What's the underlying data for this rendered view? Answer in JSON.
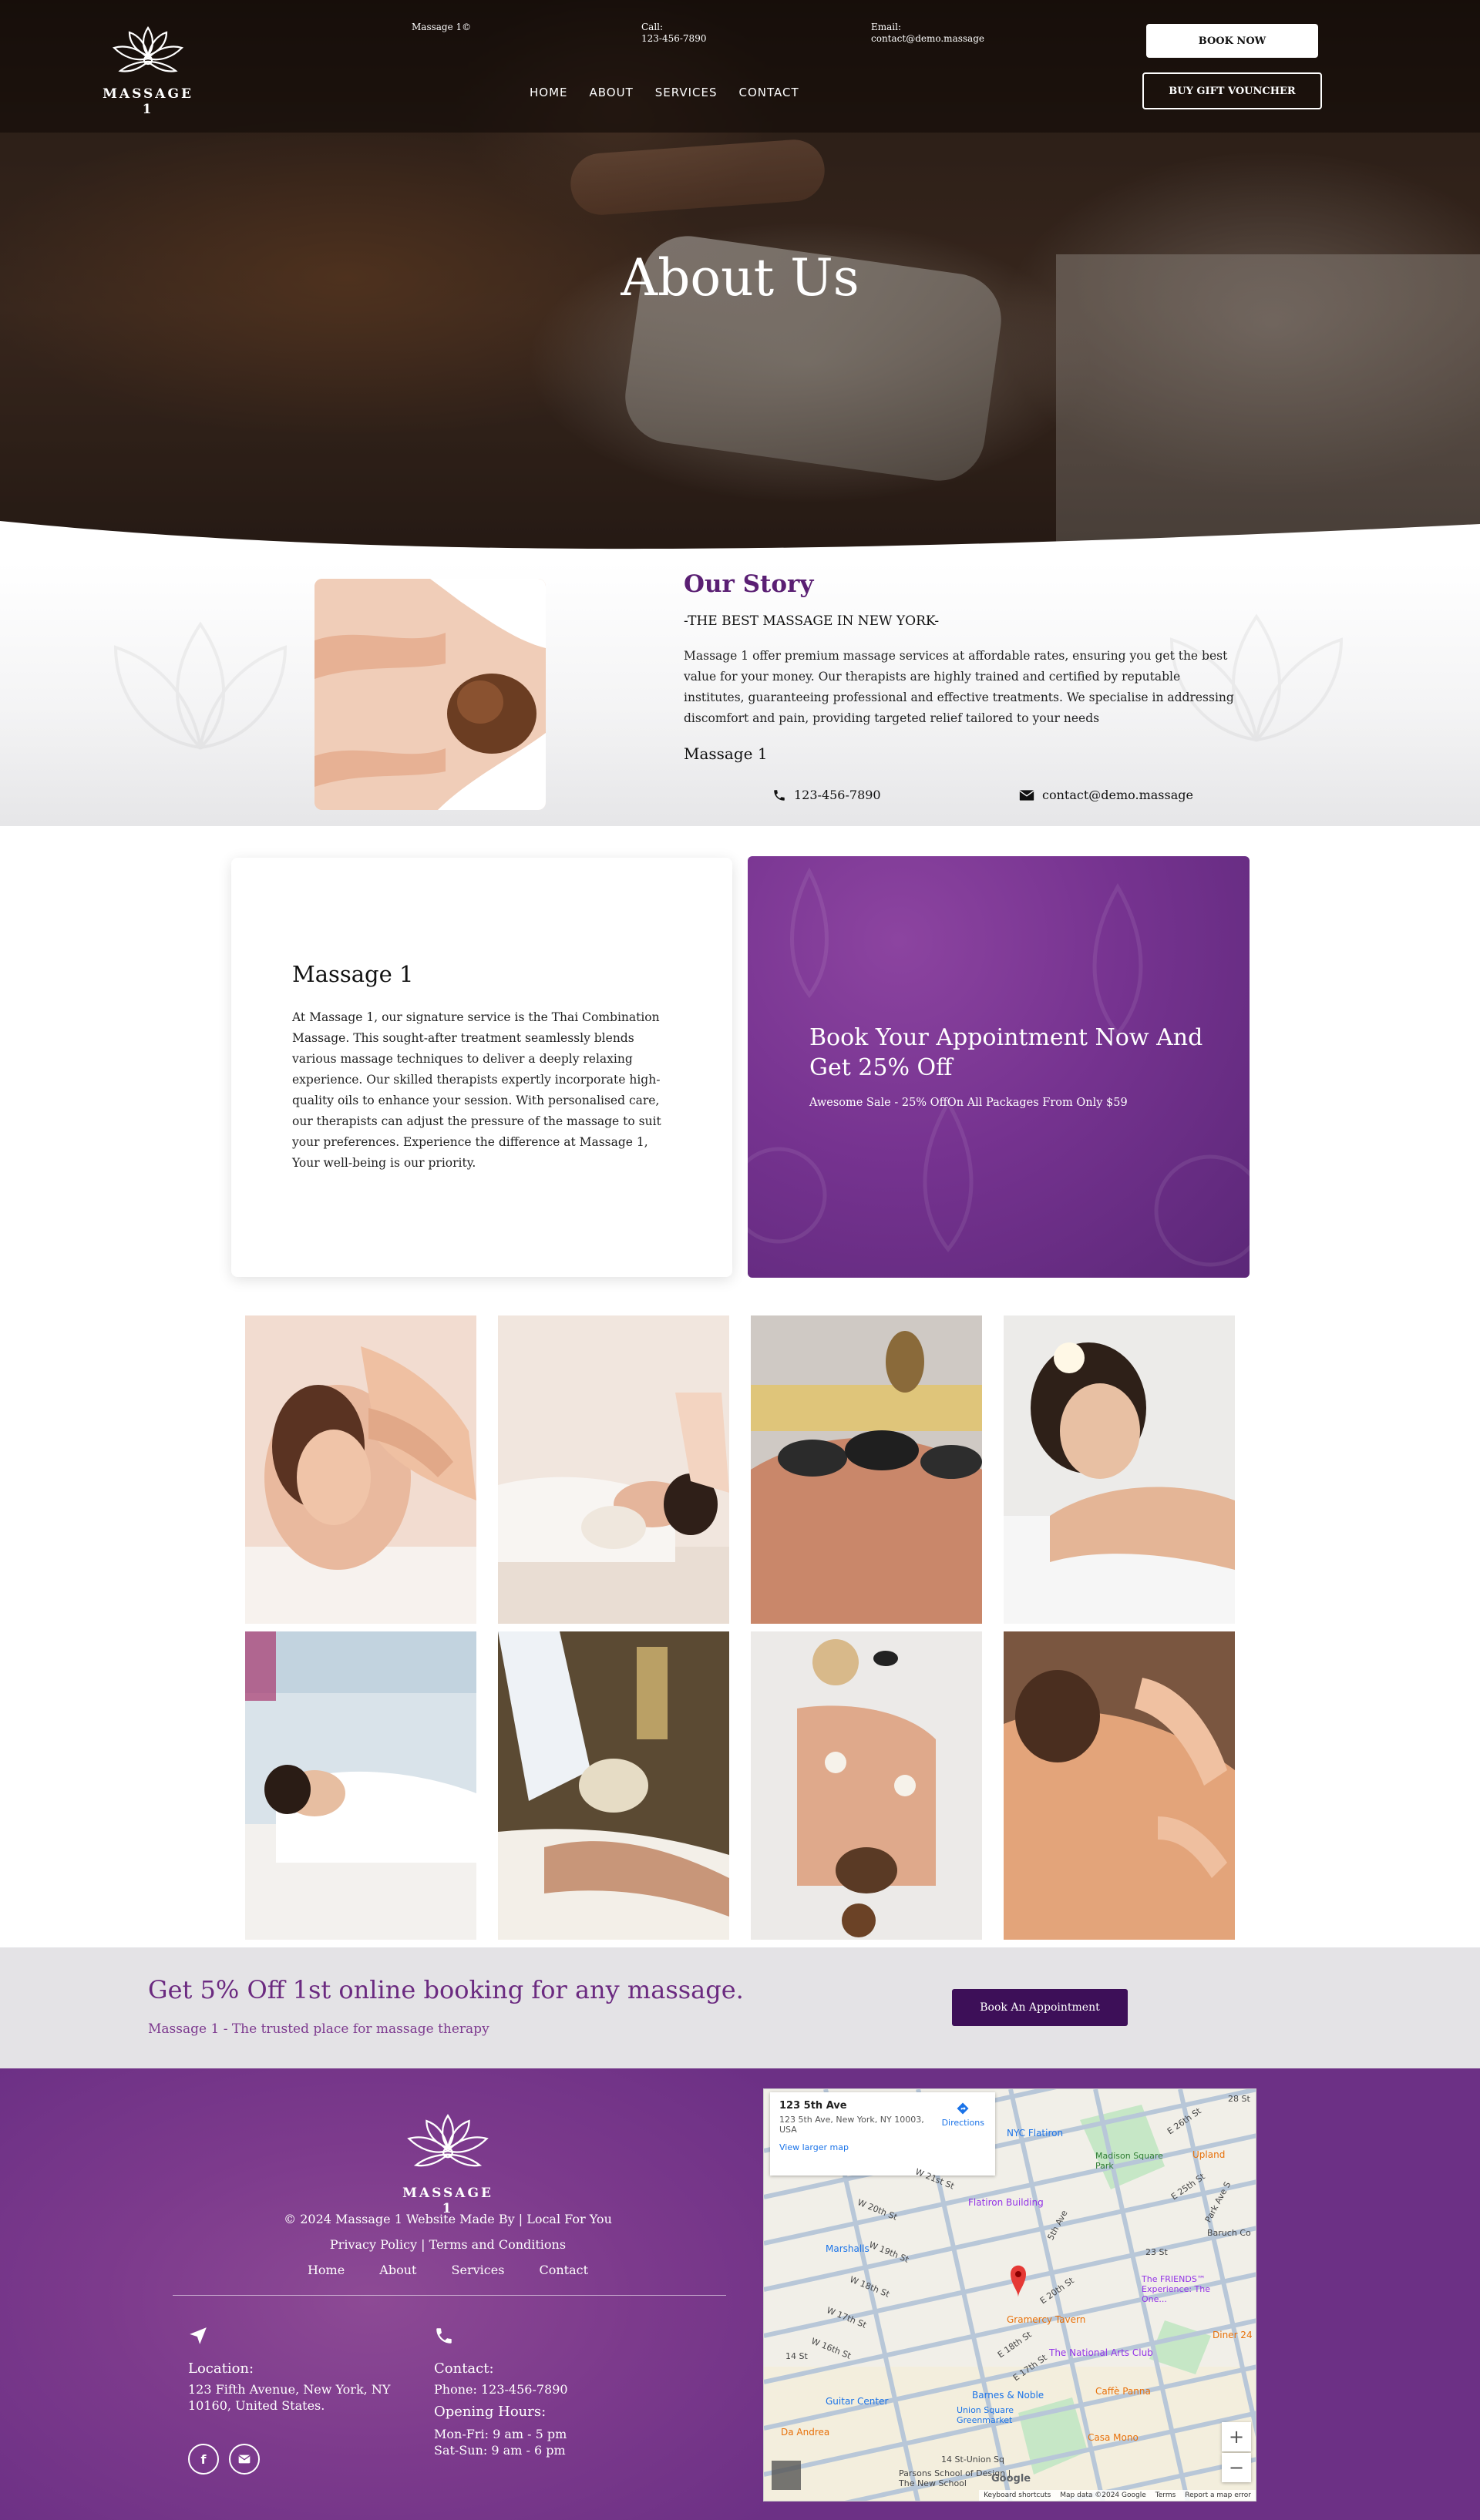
{
  "header": {
    "brand": "Massage 1",
    "logo_text": "MASSAGE 1",
    "site_name": "Massage 1©",
    "call_label": "Call:",
    "call_value": "123-456-7890",
    "email_label": "Email:",
    "email_value": "contact@demo.massage",
    "nav": [
      "HOME",
      "ABOUT",
      "SERVICES",
      "CONTACT"
    ],
    "book_now": "BOOK NOW",
    "gift_voucher": "BUY GIFT VOUNCHER"
  },
  "hero": {
    "title": "About Us"
  },
  "story": {
    "title": "Our Story",
    "subtitle": "-THE BEST MASSAGE IN NEW YORK-",
    "text": "Massage 1 offer premium massage services at affordable rates, ensuring you get the best value for your money. Our therapists are highly trained and certified by reputable institutes, guaranteeing professional and effective treatments. We specialise in addressing discomfort and pain, providing targeted relief tailored to your needs",
    "name": "Massage 1",
    "phone": "123-456-7890",
    "email": "contact@demo.massage"
  },
  "service_card": {
    "title": "Massage 1",
    "text": "At Massage 1, our signature service is the Thai Combination Massage. This sought-after treatment seamlessly blends various massage techniques to deliver a deeply relaxing experience. Our skilled therapists expertly incorporate high-quality oils to enhance your session. With personalised care, our therapists can adjust the pressure of the massage to suit your preferences. Experience the difference at Massage 1, Your well-being is our priority."
  },
  "offer_card": {
    "title": "Book Your Appointment Now And Get 25% Off",
    "text": "Awesome Sale - 25% OffOn All Packages From Only $59"
  },
  "gallery": {
    "items": [
      "shoulder-massage-photo",
      "head-massage-photo",
      "hot-stone-photo",
      "relaxing-woman-photo",
      "spa-rest-photo",
      "herbal-compress-photo",
      "back-treatment-photo",
      "back-massage-photo"
    ]
  },
  "promo": {
    "title": "Get 5% Off 1st online booking for any massage.",
    "subtitle": "Massage 1 - The trusted place for massage therapy",
    "button": "Book An Appointment"
  },
  "footer": {
    "logo_text": "MASSAGE 1",
    "copyright": "© 2024 Massage 1 Website Made By | Local For You",
    "legal": "Privacy Policy | Terms and Conditions",
    "links": [
      "Home",
      "About",
      "Services",
      "Contact"
    ],
    "location_label": "Location:",
    "location_value": "123 Fifth Avenue, New York, NY 10160, United States.",
    "contact_label": "Contact:",
    "contact_phone": "Phone: 123-456-7890",
    "hours_label": "Opening Hours:",
    "hours_weekday": "Mon-Fri: 9 am - 5 pm",
    "hours_weekend": "Sat-Sun: 9 am - 6 pm",
    "social": [
      "facebook-icon",
      "email-icon"
    ]
  },
  "map": {
    "place_title": "123 5th Ave",
    "place_address": "123 5th Ave, New York, NY 10003, USA",
    "larger_map": "View larger map",
    "directions": "Directions",
    "labels": [
      "28 St",
      "NYC Flatiron",
      "Madison Square Park",
      "Upland",
      "Flatiron Building",
      "23 St",
      "Baruch Co",
      "Marshalls",
      "The FRIENDS™ Experience: The One...",
      "Gramercy Tavern",
      "Diner 24",
      "The National Arts Club",
      "14 St",
      "Guitar Center",
      "Barnes & Noble",
      "Union Square Greenmarket",
      "Caffè Panna",
      "Da Andrea",
      "Casa Mono",
      "14 St-Union Sq",
      "Parsons School of Design | The New School",
      "W 20th St",
      "W 19th St",
      "W 18th St",
      "W 17th St",
      "W 16th St",
      "W 21st St",
      "E 20th St",
      "E 18th St",
      "E 17th St",
      "E 26th St",
      "E 25th St",
      "5th Ave",
      "Park Ave S"
    ],
    "footer": [
      "Keyboard shortcuts",
      "Map data ©2024 Google",
      "Terms",
      "Report a map error"
    ],
    "google": "Google"
  }
}
